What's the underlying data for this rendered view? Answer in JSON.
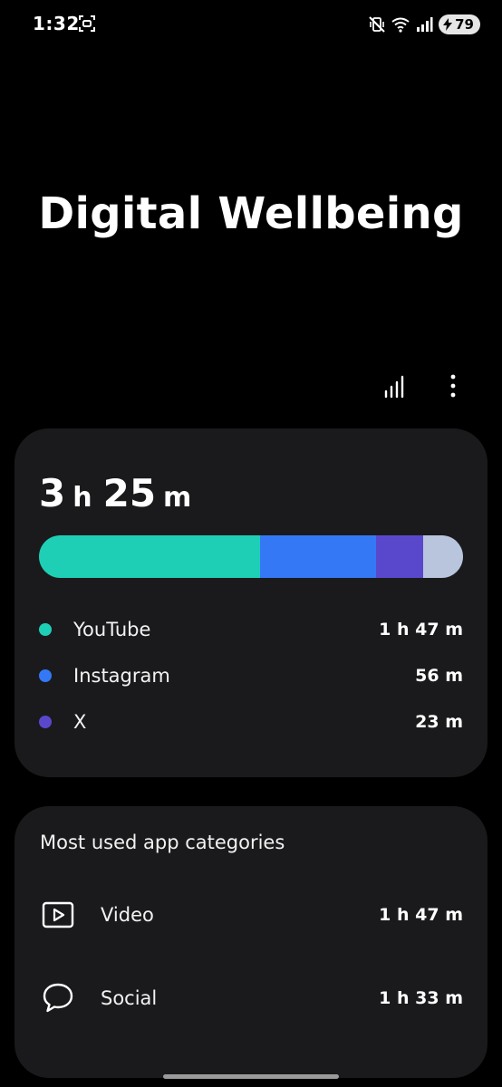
{
  "status_bar": {
    "time": "1:32",
    "battery_level": "79",
    "icons": [
      "screen-record-icon",
      "vibrate-mute-icon",
      "wifi-icon",
      "cell-signal-icon",
      "battery-charging-icon"
    ]
  },
  "header": {
    "title": "Digital Wellbeing",
    "actions": [
      "bar-chart-icon",
      "more-vertical-icon"
    ]
  },
  "screen_time": {
    "hours": "3",
    "hours_unit": "h",
    "minutes": "25",
    "minutes_unit": "m",
    "segments": [
      {
        "app": "YouTube",
        "fraction": 0.522,
        "color": "#1ecfb6"
      },
      {
        "app": "Instagram",
        "fraction": 0.273,
        "color": "#3478f6"
      },
      {
        "app": "X",
        "fraction": 0.112,
        "color": "#5a48cc"
      },
      {
        "app": "Other",
        "fraction": 0.093,
        "color": "#b8c5dd"
      }
    ],
    "apps": [
      {
        "name": "YouTube",
        "time": "1 h 47 m",
        "color": "#1ecfb6"
      },
      {
        "name": "Instagram",
        "time": "56 m",
        "color": "#3478f6"
      },
      {
        "name": "X",
        "time": "23 m",
        "color": "#5a48cc"
      }
    ]
  },
  "categories": {
    "title": "Most used app categories",
    "items": [
      {
        "name": "Video",
        "time": "1 h 47 m",
        "icon": "video-play-icon"
      },
      {
        "name": "Social",
        "time": "1 h 33 m",
        "icon": "chat-bubble-icon"
      }
    ]
  }
}
